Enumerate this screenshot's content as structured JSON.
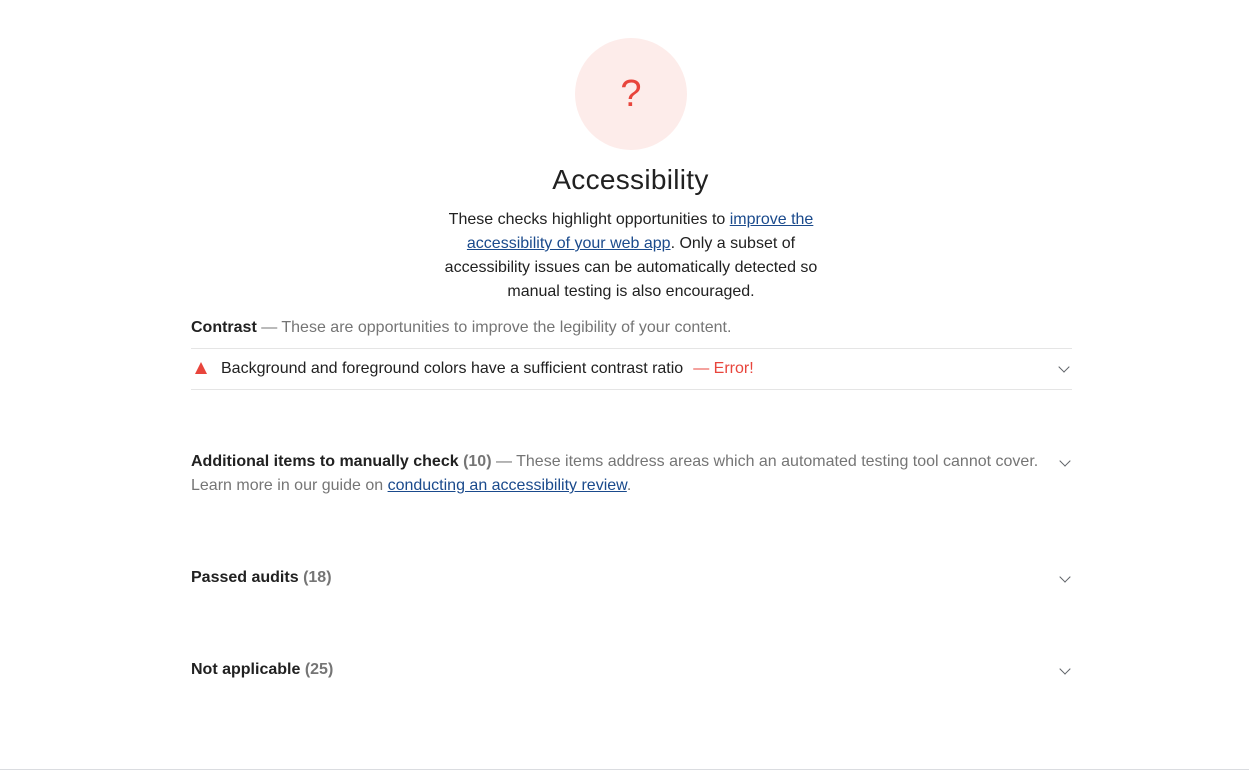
{
  "gauge": {
    "symbol": "?",
    "color": "#e8453c",
    "background": "#fdecea"
  },
  "category": {
    "title": "Accessibility",
    "description_start": "These checks highlight opportunities to ",
    "description_link": "improve the accessibility of your web app",
    "description_end": ". Only a subset of accessibility issues can be automatically detected so manual testing is also encouraged."
  },
  "contrast_group": {
    "title": "Contrast",
    "description": " — These are opportunities to improve the legibility of your content."
  },
  "audit": {
    "title": "Background and foreground colors have a sufficient contrast ratio",
    "error": "— Error!",
    "status_icon": "fail-triangle-icon"
  },
  "manual_group": {
    "title": "Additional items to manually check",
    "count": "(10)",
    "description": " — These items address areas which an automated testing tool cannot cover.",
    "learn_more": "Learn more in our guide on ",
    "link": "conducting an accessibility review",
    "period": "."
  },
  "passed_group": {
    "title": "Passed audits",
    "count": "(18)"
  },
  "not_applicable_group": {
    "title": "Not applicable",
    "count": "(25)"
  },
  "colors": {
    "error": "#e8453c",
    "link": "#1a4a8c",
    "secondary_text": "#757575"
  }
}
